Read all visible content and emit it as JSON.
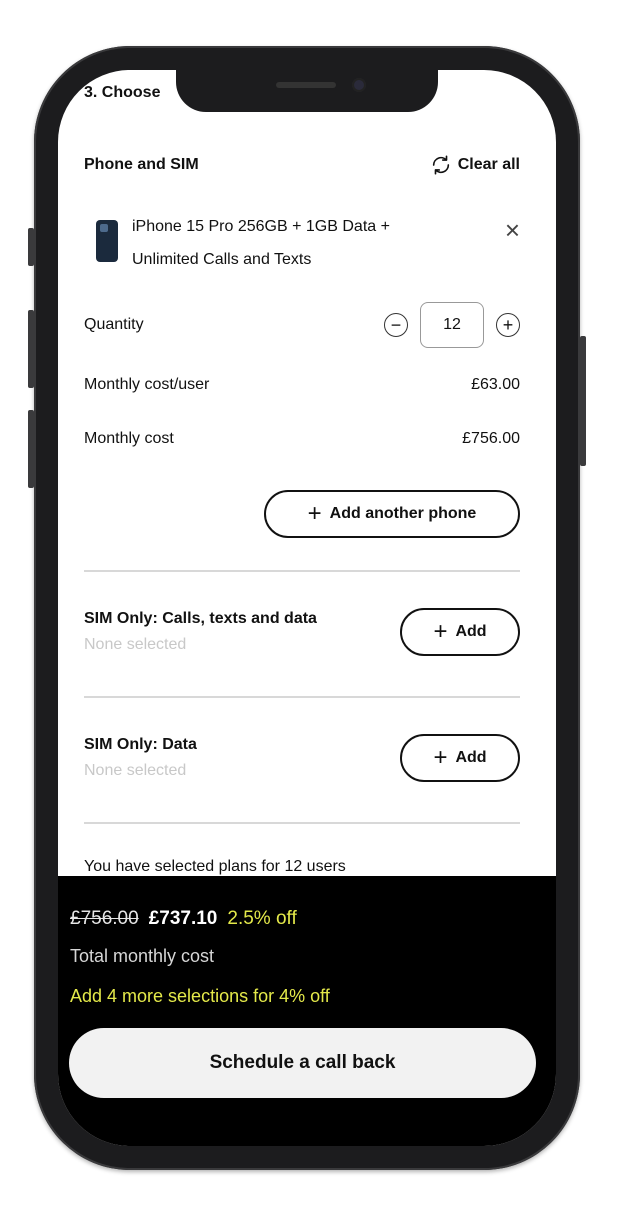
{
  "step_title": "3. Choose",
  "section": {
    "title": "Phone and SIM",
    "clear_all_label": "Clear all",
    "refresh_icon": "refresh-icon"
  },
  "product": {
    "name": "iPhone 15 Pro 256GB + 1GB Data + Unlimited Calls and Texts",
    "remove_icon": "close-icon"
  },
  "quantity": {
    "label": "Quantity",
    "value": "12",
    "decrement_symbol": "−",
    "increment_symbol": "+"
  },
  "costs": {
    "per_user_label": "Monthly cost/user",
    "per_user_value": "£63.00",
    "monthly_label": "Monthly cost",
    "monthly_value": "£756.00"
  },
  "add_phone_label": "Add another phone",
  "sim_options": [
    {
      "title": "SIM Only: Calls, texts and data",
      "status": "None selected",
      "add_label": "Add"
    },
    {
      "title": "SIM Only: Data",
      "status": "None selected",
      "add_label": "Add"
    }
  ],
  "selection_summary": "You have selected plans for 12 users",
  "footer": {
    "old_price": "£756.00",
    "new_price": "£737.10",
    "discount": "2.5% off",
    "total_label": "Total monthly cost",
    "promo": "Add 4 more selections for 4% off",
    "cta_label": "Schedule a call back"
  },
  "colors": {
    "accent_yellow": "#e4e94a",
    "footer_bg": "#000000",
    "placeholder_gray": "#c8c8c8"
  }
}
